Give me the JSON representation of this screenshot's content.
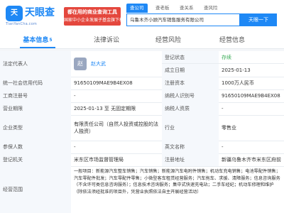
{
  "header": {
    "logo_glyph": "天",
    "logo_text": "天眼查",
    "logo_sub": "TianYanCha.com",
    "promo_line1": "都在用的商业查询工具",
    "promo_line2": "国家中小企业发展子基金旗下机构",
    "search_tabs": [
      "查公司",
      "查老板",
      "查关系",
      "查风险"
    ],
    "search_value": "乌鲁木齐小顾汽车销售服务有限公司",
    "search_button": "天眼一下"
  },
  "tabs": [
    {
      "label": "基本信息",
      "count": "5",
      "active": true
    },
    {
      "label": "法律诉讼",
      "count": "",
      "active": false
    },
    {
      "label": "经营风险",
      "count": "",
      "active": false
    },
    {
      "label": "经营信息",
      "count": "",
      "active": false
    }
  ],
  "info": {
    "legal_rep_label": "法定代表人",
    "avatar_char": "赵",
    "legal_rep_name": "赵大武",
    "reg_status_label": "登记状态",
    "reg_status": "存续",
    "est_date_label": "成立日期",
    "est_date": "2025-01-13",
    "credit_code_label": "统一社会信用代码",
    "credit_code": "91650109MAE9B4EX08",
    "reg_capital_label": "注册资本",
    "reg_capital": "1000万人民币",
    "biz_reg_no_label": "工商注册号",
    "biz_reg_no": "-",
    "taxpayer_id_label": "纳税人识别号",
    "taxpayer_id": "91650109MAE9B4EX08",
    "biz_term_label": "营业期限",
    "biz_term": "2025-01-13 至 无固定期限",
    "taxpayer_qual_label": "纳税人资质",
    "taxpayer_qual": "-",
    "company_type_label": "企业类型",
    "company_type": "有限责任公司（自然人投资或控股的法人独资）",
    "industry_label": "行业",
    "industry": "零售业",
    "insured_label": "参保人数",
    "insured": "-",
    "english_name_label": "英文名称",
    "english_name": "-",
    "reg_authority_label": "登记机关",
    "reg_authority": "米东区市场监督管理局",
    "reg_address_label": "注册地址",
    "reg_address": "新疆乌鲁木齐市米东区府前",
    "scope_label": "经营范围",
    "scope": "一般项目：新能源汽车整车销售；汽车销售；新能源汽车电附件销售；机动车充电销售；电池零配件销售；汽车零配件批发；汽车零配件零售；小微型客车租赁经营服务；汽车拖车、求援、清障服务；信息咨询服务（不含许可类信息咨询服务）；信息技术咨询服务；集中式快速充电站；二手车经纪；机动车修理和维护（除依法须经批准的项目外，凭营业执照依法自主开展经营活动）"
  }
}
